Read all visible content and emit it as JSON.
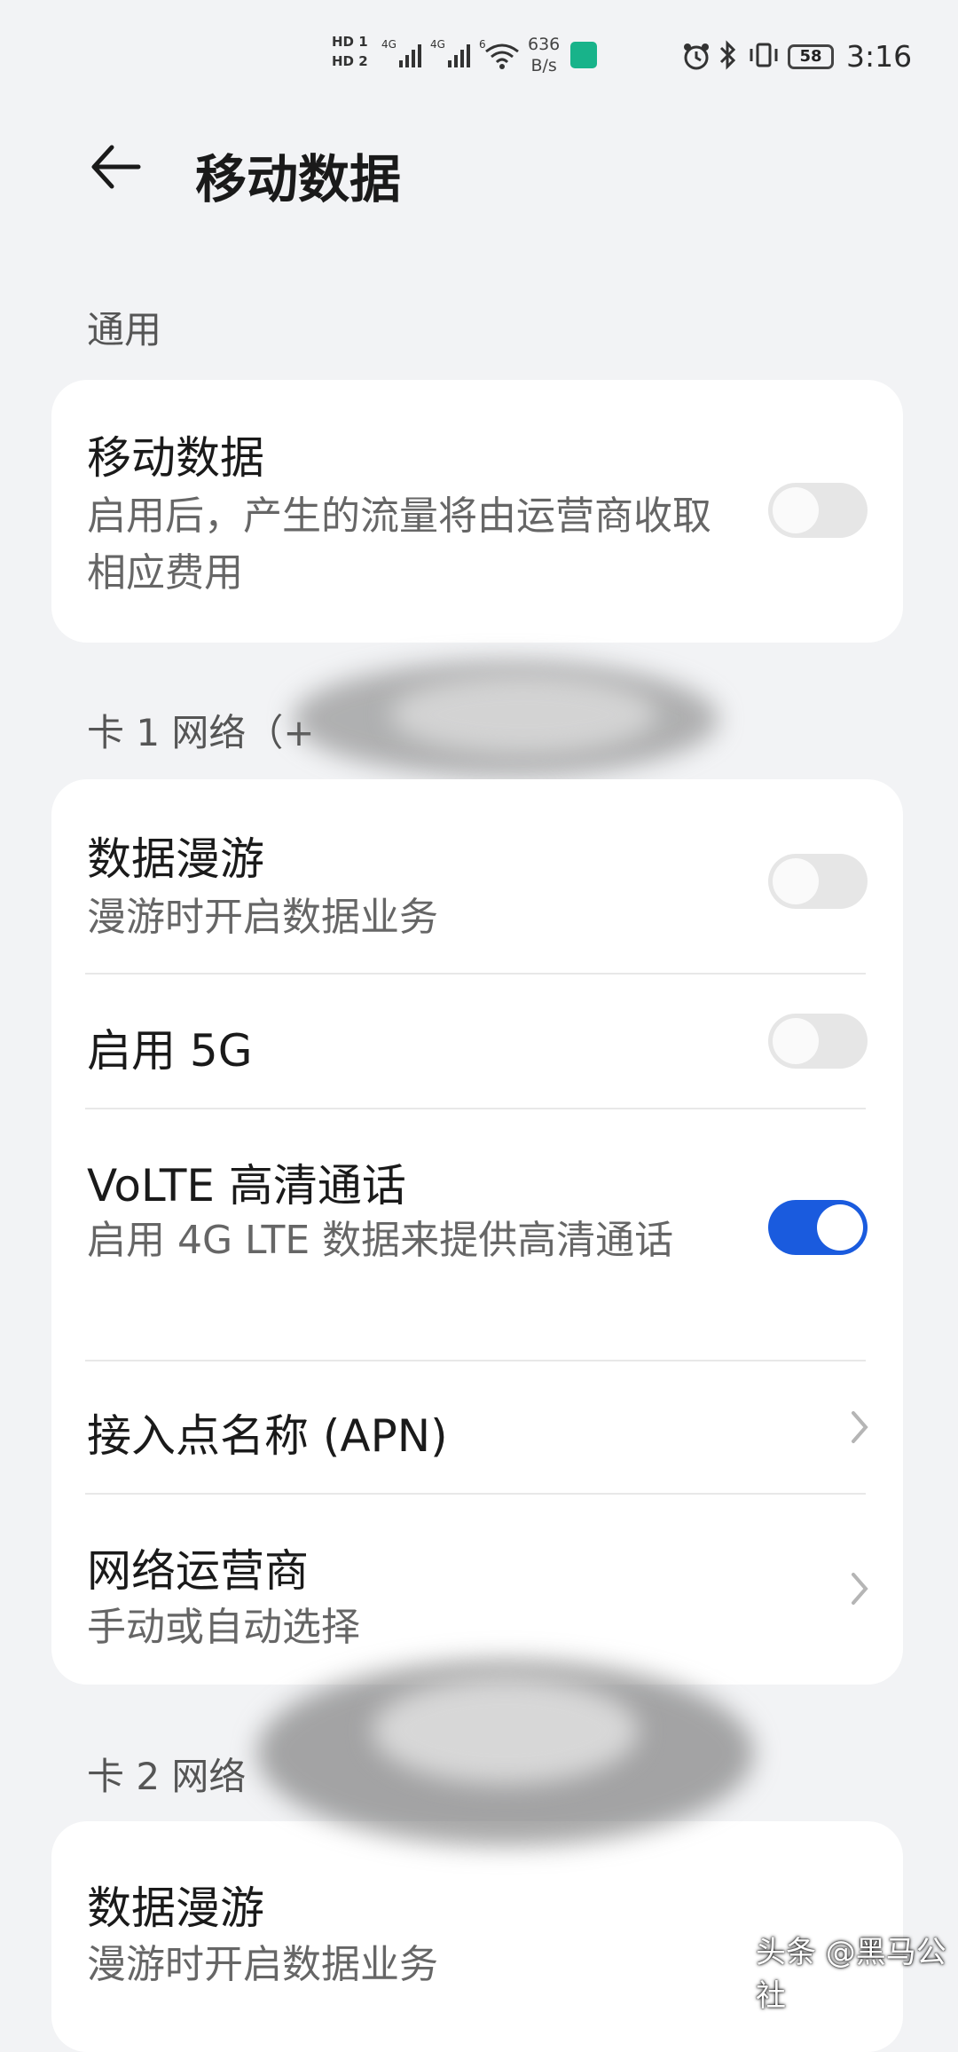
{
  "status_bar": {
    "hd1": "HD 1",
    "hd2": "HD 2",
    "net_type_1": "4G",
    "net_type_2": "4G",
    "wifi_label": "6",
    "net_speed_value": "636",
    "net_speed_unit": "B/s",
    "battery": "58",
    "time": "3:16"
  },
  "header": {
    "title": "移动数据"
  },
  "general": {
    "section_label": "通用",
    "mobile_data": {
      "title": "移动数据",
      "subtitle": "启用后，产生的流量将由运营商收取相应费用",
      "enabled": false
    }
  },
  "sim1": {
    "section_label": "卡 1 网络（+",
    "data_roaming": {
      "title": "数据漫游",
      "subtitle": "漫游时开启数据业务",
      "enabled": false
    },
    "enable_5g": {
      "title": "启用 5G",
      "enabled": false
    },
    "volte": {
      "title": "VoLTE 高清通话",
      "subtitle": "启用 4G LTE 数据来提供高清通话",
      "enabled": true
    },
    "apn": {
      "title": "接入点名称 (APN)"
    },
    "operator": {
      "title": "网络运营商",
      "subtitle": "手动或自动选择"
    }
  },
  "sim2": {
    "section_label": "卡 2 网络",
    "data_roaming": {
      "title": "数据漫游",
      "subtitle": "漫游时开启数据业务"
    }
  },
  "watermark": "头条 @黑马公社",
  "colors": {
    "accent": "#1a5bde",
    "background": "#f2f3f5",
    "card": "#ffffff"
  }
}
